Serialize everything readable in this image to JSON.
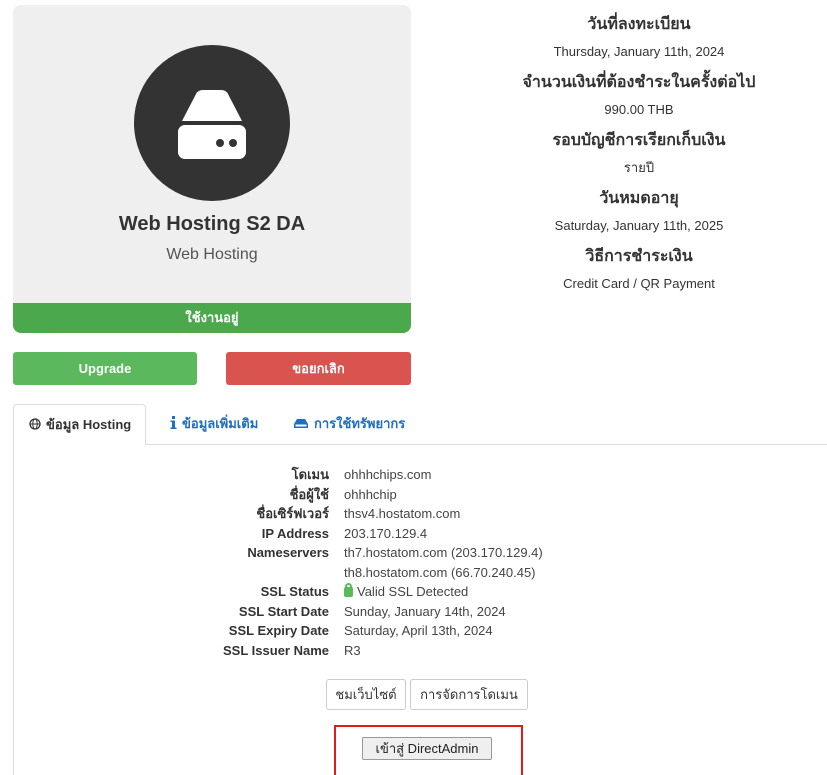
{
  "product": {
    "name": "Web Hosting S2 DA",
    "group": "Web Hosting",
    "status": "ใช้งานอยู่",
    "icon": "server-icon"
  },
  "actions": {
    "upgrade_label": "Upgrade",
    "cancel_label": "ขอยกเลิก"
  },
  "info": [
    {
      "label": "วันที่ลงทะเบียน",
      "value": "Thursday, January 11th, 2024"
    },
    {
      "label": "จำนวนเงินที่ต้องชำระในครั้งต่อไป",
      "value": "990.00 THB"
    },
    {
      "label": "รอบบัญชีการเรียกเก็บเงิน",
      "value": "รายปี"
    },
    {
      "label": "วันหมดอายุ",
      "value": "Saturday, January 11th, 2025"
    },
    {
      "label": "วิธีการชำระเงิน",
      "value": "Credit Card / QR Payment"
    }
  ],
  "tabs": [
    {
      "label": "ข้อมูล Hosting",
      "icon": "globe-icon"
    },
    {
      "label": "ข้อมูลเพิ่มเติม",
      "icon": "info-icon"
    },
    {
      "label": "การใช้ทรัพยากร",
      "icon": "hdd-icon"
    }
  ],
  "details": {
    "domain_label": "โดเมน",
    "domain": "ohhhchips.com",
    "username_label": "ชื่อผู้ใช้",
    "username": "ohhhchip",
    "server_label": "ชื่อเซิร์ฟเวอร์",
    "server": "thsv4.hostatom.com",
    "ip_label": "IP Address",
    "ip": "203.170.129.4",
    "ns_label": "Nameservers",
    "ns1": "th7.hostatom.com (203.170.129.4)",
    "ns2": "th8.hostatom.com (66.70.240.45)",
    "ssl_status_label": "SSL Status",
    "ssl_status": "Valid SSL Detected",
    "ssl_start_label": "SSL Start Date",
    "ssl_start": "Sunday, January 14th, 2024",
    "ssl_expiry_label": "SSL Expiry Date",
    "ssl_expiry": "Saturday, April 13th, 2024",
    "ssl_issuer_label": "SSL Issuer Name",
    "ssl_issuer": "R3"
  },
  "buttons": {
    "visit_site": "ชมเว็บไซต์",
    "manage_domain": "การจัดการโดเมน",
    "login_da": "เข้าสู่ DirectAdmin"
  },
  "colors": {
    "active": "#4ca84d",
    "upgrade": "#5cb85c",
    "cancel": "#d9534f",
    "link": "#1f6ec0",
    "highlight": "#e01b1b"
  }
}
